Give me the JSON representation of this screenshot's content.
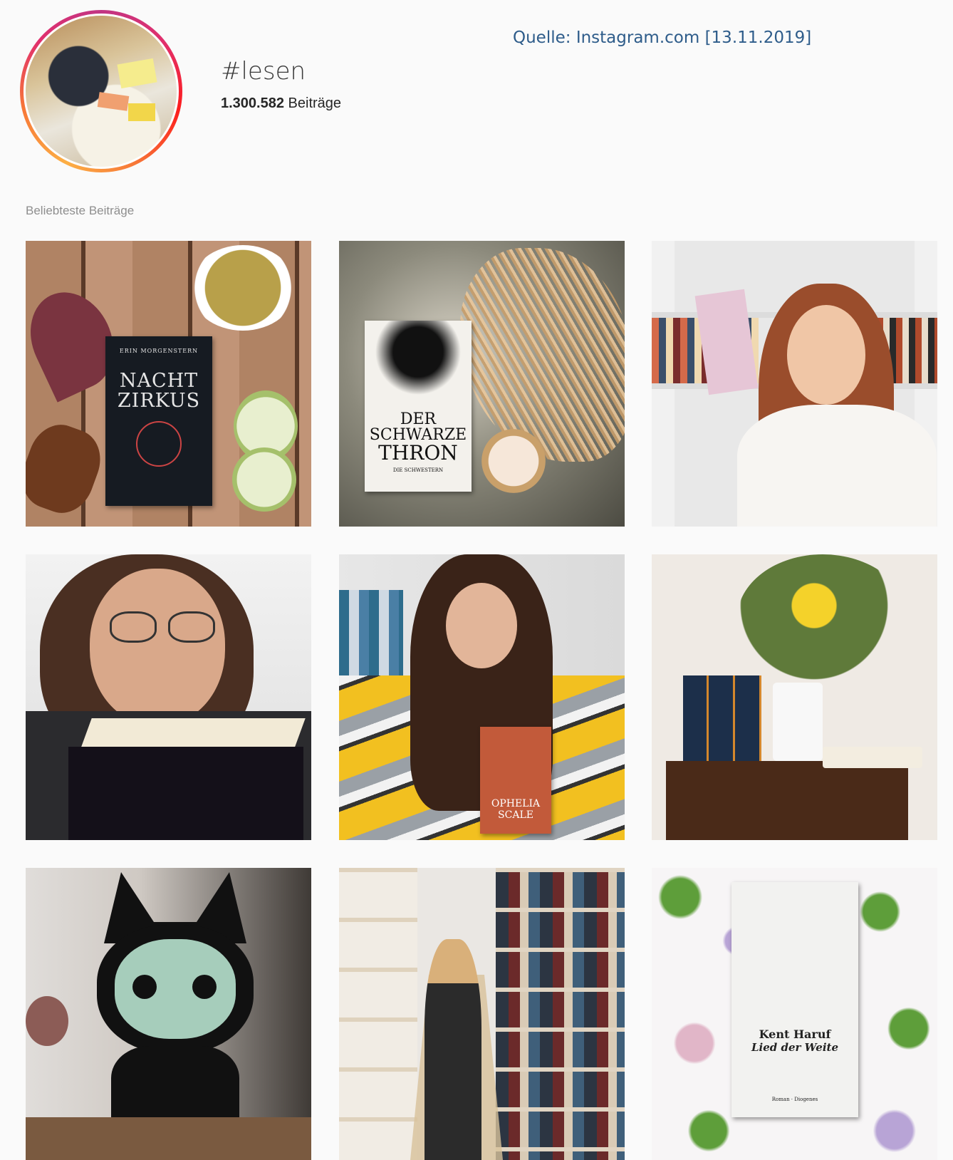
{
  "source_note": "Quelle: Instagram.com [13.11.2019]",
  "header": {
    "hashtag": "#lesen",
    "post_count": "1.300.582",
    "post_count_label": " Beiträge"
  },
  "section_title": "Beliebteste Beiträge",
  "posts": {
    "p1": {
      "author": "ERIN MORGENSTERN",
      "title_line1": "NACHT",
      "title_line2": "ZIRKUS"
    },
    "p2": {
      "title_line1": "DER",
      "title_line2": "SCHWARZE",
      "title_line3": "THRON",
      "subtitle": "DIE SCHWESTERN"
    },
    "p5": {
      "title": "OPHELIA SCALE"
    },
    "p9": {
      "author": "Kent Haruf",
      "title": "Lied der Weite",
      "publisher": "Roman · Diogenes"
    }
  },
  "colors": {
    "background": "#fafafa",
    "source_text": "#2e5c8a",
    "ring_gradient": [
      "#c13584",
      "#e1306c",
      "#fd1d1d",
      "#f77737",
      "#fcaf45"
    ]
  }
}
